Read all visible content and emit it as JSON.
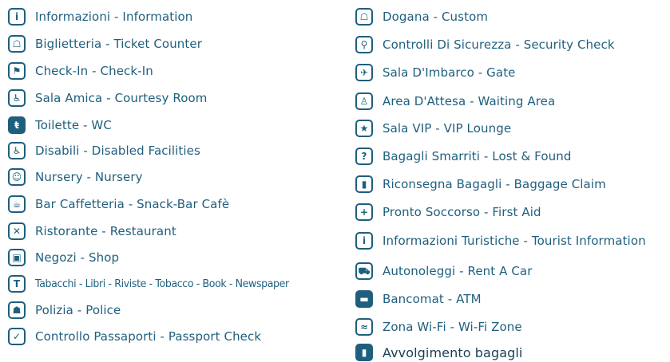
{
  "left": [
    {
      "label": "Informazioni - Information",
      "icon": "info-icon",
      "glyph": "i",
      "filled": false
    },
    {
      "label": "Biglietteria - Ticket Counter",
      "icon": "ticket-counter-icon",
      "glyph": "☖",
      "filled": false
    },
    {
      "label": "Check-In - Check-In",
      "icon": "check-in-icon",
      "glyph": "⚑",
      "filled": false
    },
    {
      "label": "Sala Amica - Courtesy Room",
      "icon": "courtesy-room-icon",
      "glyph": "♿",
      "filled": false
    },
    {
      "label": "Toilette - WC",
      "icon": "toilet-icon",
      "glyph": "ŧ",
      "filled": true
    },
    {
      "label": "Disabili - Disabled Facilities",
      "icon": "disabled-facilities-icon",
      "glyph": "♿",
      "filled": false
    },
    {
      "label": "Nursery - Nursery",
      "icon": "nursery-icon",
      "glyph": "☺",
      "filled": false
    },
    {
      "label": "Bar Caffetteria - Snack-Bar Cafè",
      "icon": "cafe-icon",
      "glyph": "☕",
      "filled": false
    },
    {
      "label": "Ristorante - Restaurant",
      "icon": "restaurant-icon",
      "glyph": "✕",
      "filled": false
    },
    {
      "label": "Negozi - Shop",
      "icon": "shop-icon",
      "glyph": "▣",
      "filled": false
    },
    {
      "label": "Tabacchi - Libri - Riviste - Tobacco - Book - Newspaper",
      "icon": "tobacco-book-icon",
      "glyph": "T",
      "filled": false
    },
    {
      "label": "Polizia - Police",
      "icon": "police-icon",
      "glyph": "☗",
      "filled": false
    },
    {
      "label": "Controllo Passaporti - Passport Check",
      "icon": "passport-check-icon",
      "glyph": "✓",
      "filled": false
    }
  ],
  "right": [
    {
      "label": "Dogana - Custom",
      "icon": "customs-icon",
      "glyph": "☖",
      "filled": false
    },
    {
      "label": "Controlli Di Sicurezza - Security Check",
      "icon": "security-check-icon",
      "glyph": "⚲",
      "filled": false
    },
    {
      "label": "Sala D'Imbarco - Gate",
      "icon": "gate-icon",
      "glyph": "✈",
      "filled": false
    },
    {
      "label": "Area D'Attesa - Waiting Area",
      "icon": "waiting-area-icon",
      "glyph": "♙",
      "filled": false
    },
    {
      "label": "Sala VIP - VIP Lounge",
      "icon": "vip-lounge-icon",
      "glyph": "★",
      "filled": false
    },
    {
      "label": "Bagagli Smarriti - Lost & Found",
      "icon": "lost-found-icon",
      "glyph": "?",
      "filled": false
    },
    {
      "label": "Riconsegna Bagagli - Baggage Claim",
      "icon": "baggage-claim-icon",
      "glyph": "▮",
      "filled": false
    },
    {
      "label": "Pronto Soccorso - First Aid",
      "icon": "first-aid-icon",
      "glyph": "+",
      "filled": false
    },
    {
      "label": "Informazioni Turistiche - Tourist Information",
      "icon": "tourist-info-icon",
      "glyph": "i",
      "filled": false
    },
    {
      "label": "Autonoleggi - Rent A Car",
      "icon": "rent-a-car-icon",
      "glyph": "⛟",
      "filled": false
    },
    {
      "label": "Bancomat - ATM",
      "icon": "atm-icon",
      "glyph": "▬",
      "filled": true
    },
    {
      "label": "Zona Wi-Fi - Wi-Fi Zone",
      "icon": "wifi-icon",
      "glyph": "≈",
      "filled": false
    },
    {
      "label": "Avvolgimento bagagli",
      "icon": "baggage-wrapping-icon",
      "glyph": "▮",
      "filled": true
    }
  ]
}
